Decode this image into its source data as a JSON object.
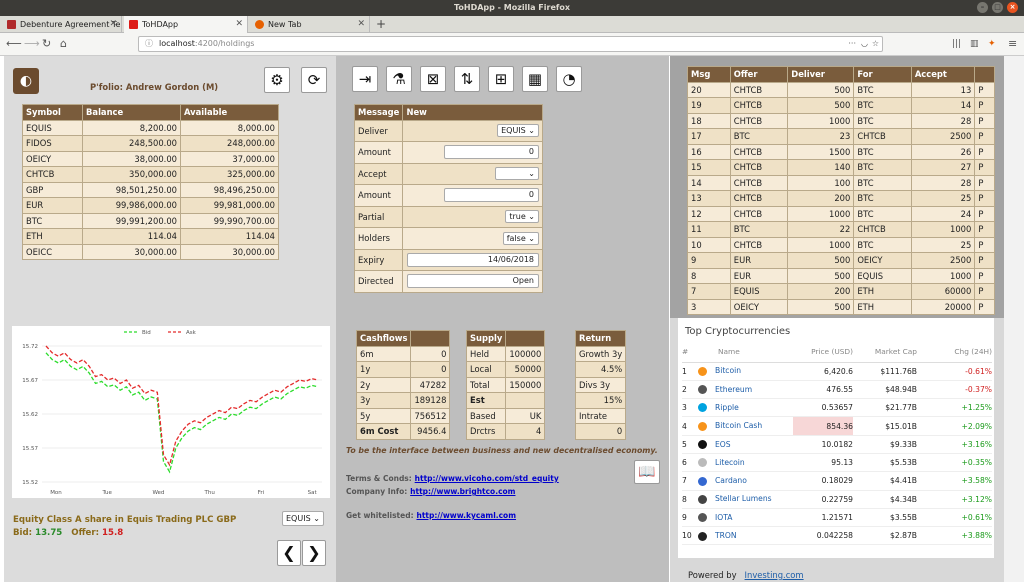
{
  "window": {
    "title": "ToHDApp - Mozilla Firefox"
  },
  "tabs": [
    {
      "label": "Debenture Agreement Te",
      "color": "#b02a2a"
    },
    {
      "label": "ToHDApp",
      "color": "#dd1b16"
    },
    {
      "label": "New Tab",
      "color": "#e66000"
    }
  ],
  "url": {
    "host": "localhost",
    "path": ":4200/holdings"
  },
  "portfolio": {
    "name": "P'folio: Andrew Gordon (M)",
    "headers": [
      "Symbol",
      "Balance",
      "Available"
    ],
    "rows": [
      [
        "EQUIS",
        "8,200.00",
        "8,000.00"
      ],
      [
        "FIDOS",
        "248,500.00",
        "248,000.00"
      ],
      [
        "OEICY",
        "38,000.00",
        "37,000.00"
      ],
      [
        "CHTCB",
        "350,000.00",
        "325,000.00"
      ],
      [
        "GBP",
        "98,501,250.00",
        "98,496,250.00"
      ],
      [
        "EUR",
        "99,986,000.00",
        "99,981,000.00"
      ],
      [
        "BTC",
        "99,991,200.00",
        "99,990,700.00"
      ],
      [
        "ETH",
        "114.04",
        "114.04"
      ],
      [
        "OEICC",
        "30,000.00",
        "30,000.00"
      ]
    ]
  },
  "message_form": {
    "title": "Message",
    "status": "New",
    "deliver_label": "Deliver",
    "deliver_value": "EQUIS",
    "amount1_label": "Amount",
    "amount1_value": "0",
    "accept_label": "Accept",
    "accept_value": "",
    "amount2_label": "Amount",
    "amount2_value": "0",
    "partial_label": "Partial",
    "partial_value": "true",
    "holders_label": "Holders",
    "holders_value": "false",
    "expiry_label": "Expiry",
    "expiry_value": "14/06/2018",
    "directed_label": "Directed",
    "directed_value": "Open"
  },
  "offers": {
    "headers": [
      "Msg",
      "Offer",
      "Deliver",
      "For",
      "Accept",
      ""
    ],
    "rows": [
      [
        "20",
        "CHTCB",
        "500",
        "BTC",
        "13",
        "P"
      ],
      [
        "19",
        "CHTCB",
        "500",
        "BTC",
        "14",
        "P"
      ],
      [
        "18",
        "CHTCB",
        "1000",
        "BTC",
        "28",
        "P"
      ],
      [
        "17",
        "BTC",
        "23",
        "CHTCB",
        "2500",
        "P"
      ],
      [
        "16",
        "CHTCB",
        "1500",
        "BTC",
        "26",
        "P"
      ],
      [
        "15",
        "CHTCB",
        "140",
        "BTC",
        "27",
        "P"
      ],
      [
        "14",
        "CHTCB",
        "100",
        "BTC",
        "28",
        "P"
      ],
      [
        "13",
        "CHTCB",
        "200",
        "BTC",
        "25",
        "P"
      ],
      [
        "12",
        "CHTCB",
        "1000",
        "BTC",
        "24",
        "P"
      ],
      [
        "11",
        "BTC",
        "22",
        "CHTCB",
        "1000",
        "P"
      ],
      [
        "10",
        "CHTCB",
        "1000",
        "BTC",
        "25",
        "P"
      ],
      [
        "9",
        "EUR",
        "500",
        "OEICY",
        "2500",
        "P"
      ],
      [
        "8",
        "EUR",
        "500",
        "EQUIS",
        "1000",
        "P"
      ],
      [
        "7",
        "EQUIS",
        "200",
        "ETH",
        "60000",
        "P"
      ],
      [
        "3",
        "OEICY",
        "500",
        "ETH",
        "20000",
        "P"
      ]
    ]
  },
  "chart_data": {
    "type": "line",
    "x": [
      "Mon",
      "Tue",
      "Wed",
      "Thu",
      "Fri",
      "Sat"
    ],
    "ylim": [
      15.52,
      15.72
    ],
    "yticks": [
      "15.72",
      "15.67",
      "15.62",
      "15.57",
      "15.52"
    ],
    "series": [
      {
        "name": "Bid",
        "color": "#2bdc2b",
        "values": [
          15.71,
          15.7,
          15.695,
          15.7,
          15.69,
          15.685,
          15.69,
          15.68,
          15.665,
          15.668,
          15.66,
          15.663,
          15.655,
          15.66,
          15.648,
          15.652,
          15.64,
          15.645,
          15.642,
          15.55,
          15.535,
          15.57,
          15.585,
          15.595,
          15.6,
          15.597,
          15.605,
          15.61,
          15.615,
          15.612,
          15.62,
          15.618,
          15.625,
          15.63,
          15.628,
          15.635,
          15.64,
          15.645,
          15.642,
          15.65,
          15.655,
          15.66,
          15.658,
          15.662,
          15.66
        ]
      },
      {
        "name": "Ask",
        "color": "#e42b2b",
        "values": [
          15.72,
          15.71,
          15.705,
          15.71,
          15.7,
          15.695,
          15.7,
          15.69,
          15.675,
          15.678,
          15.67,
          15.673,
          15.665,
          15.67,
          15.658,
          15.662,
          15.65,
          15.655,
          15.652,
          15.56,
          15.545,
          15.58,
          15.595,
          15.605,
          15.61,
          15.607,
          15.615,
          15.62,
          15.625,
          15.622,
          15.63,
          15.628,
          15.635,
          15.64,
          15.638,
          15.645,
          15.65,
          15.655,
          15.652,
          15.66,
          15.665,
          15.67,
          15.668,
          15.672,
          15.67
        ]
      }
    ]
  },
  "equity": {
    "desc": "Equity  Class A share in Equis Trading PLC  GBP",
    "bid_label": "Bid:",
    "bid": "13.75",
    "offer_label": "Offer:",
    "offer": "15.8",
    "select": "EQUIS"
  },
  "cashflows": {
    "headers": [
      "Cashflows",
      ""
    ],
    "rows": [
      [
        "6m",
        "0"
      ],
      [
        "1y",
        "0"
      ],
      [
        "2y",
        "47282"
      ],
      [
        "3y",
        "189128"
      ],
      [
        "5y",
        "756512"
      ],
      [
        "6m Cost",
        "9456.4"
      ]
    ]
  },
  "supply": {
    "headers": [
      "Supply",
      ""
    ],
    "rows": [
      [
        "Held",
        "100000"
      ],
      [
        "Local",
        "50000"
      ],
      [
        "Total",
        "150000"
      ],
      [
        "Est",
        ""
      ],
      [
        "Based",
        "UK"
      ],
      [
        "Drctrs",
        "4"
      ]
    ]
  },
  "returns": {
    "headers": [
      "Return"
    ],
    "rows": [
      "Growth 3y",
      "4.5%",
      "Divs 3y",
      "15%",
      "Intrate",
      "0"
    ]
  },
  "tagline": "To be the interface between business and new decentralised economy.",
  "links": {
    "terms_label": "Terms & Conds:",
    "terms_url": "http://www.vicoho.com/std_equity",
    "company_label": "Company Info:",
    "company_url": "http://www.brightco.com",
    "whitelist_label": "Get whitelisted:",
    "whitelist_url": "http://www.kycaml.com"
  },
  "crypto": {
    "title": "Top Cryptocurrencies",
    "headers": [
      "#",
      "Name",
      "Price (USD)",
      "Market Cap",
      "Chg (24H)"
    ],
    "rows": [
      [
        "1",
        "Bitcoin",
        "6,420.6",
        "$111.76B",
        "-0.61%"
      ],
      [
        "2",
        "Ethereum",
        "476.55",
        "$48.94B",
        "-0.37%"
      ],
      [
        "3",
        "Ripple",
        "0.53657",
        "$21.77B",
        "+1.25%"
      ],
      [
        "4",
        "Bitcoin Cash",
        "854.36",
        "$15.01B",
        "+2.09%"
      ],
      [
        "5",
        "EOS",
        "10.0182",
        "$9.33B",
        "+3.16%"
      ],
      [
        "6",
        "Litecoin",
        "95.13",
        "$5.53B",
        "+0.35%"
      ],
      [
        "7",
        "Cardano",
        "0.18029",
        "$4.41B",
        "+3.58%"
      ],
      [
        "8",
        "Stellar Lumens",
        "0.22759",
        "$4.34B",
        "+3.12%"
      ],
      [
        "9",
        "IOTA",
        "1.21571",
        "$3.55B",
        "+0.61%"
      ],
      [
        "10",
        "TRON",
        "0.042258",
        "$2.87B",
        "+3.88%"
      ]
    ],
    "icons": [
      "#f7931a",
      "#555",
      "#00a3e0",
      "#f7931a",
      "#111",
      "#bbb",
      "#3468d1",
      "#444",
      "#555",
      "#222"
    ],
    "powered_label": "Powered by",
    "powered_link": "Investing.com"
  }
}
